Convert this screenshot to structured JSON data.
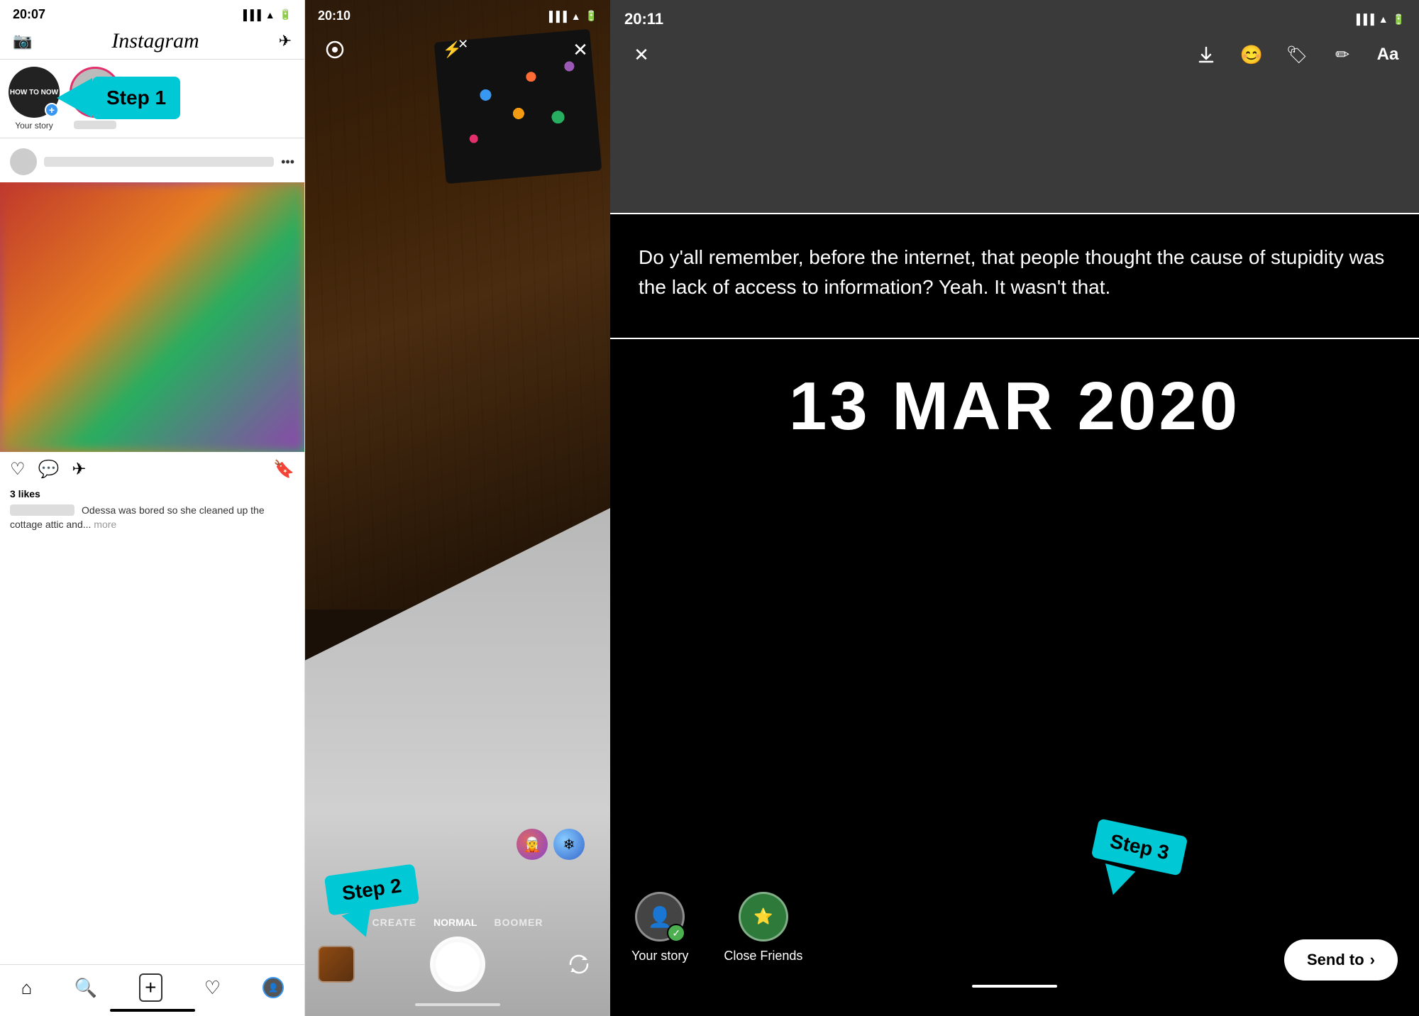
{
  "panel1": {
    "status_time": "20:07",
    "app_name": "Instagram",
    "your_story_label": "Your story",
    "step1_label": "Step 1",
    "post_likes": "3 likes",
    "post_caption": "Odessa was bored so she cleaned up the cottage attic and...",
    "post_more": "more",
    "nav": {
      "home": "⌂",
      "search": "🔍",
      "add": "⊕",
      "heart": "♡",
      "profile": "👤"
    }
  },
  "panel2": {
    "status_time": "20:10",
    "modes": [
      "CREATE",
      "NORMAL",
      "BOOMER"
    ],
    "step2_label": "Step 2"
  },
  "panel3": {
    "status_time": "20:11",
    "quote": "Do y'all remember, before the internet, that people thought the cause of stupidity was the lack of access to information?\nYeah.  It wasn't that.",
    "date": "13 MAR 2020",
    "your_story_label": "Your story",
    "close_friends_label": "Close Friends",
    "send_to_label": "Send to",
    "send_to_arrow": "›",
    "step3_label": "Step 3"
  }
}
